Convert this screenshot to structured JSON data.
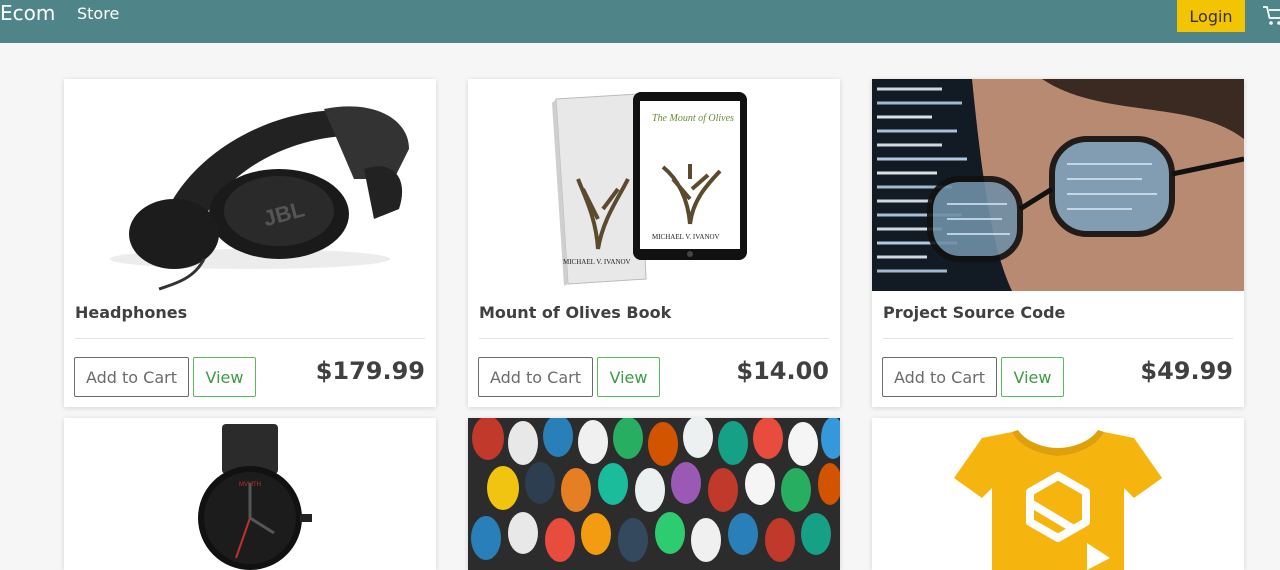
{
  "navbar": {
    "brand": "Ecom",
    "links": [
      "Store"
    ],
    "login_label": "Login"
  },
  "products": [
    {
      "title": "Headphones",
      "price": "$179.99",
      "add_label": "Add to Cart",
      "view_label": "View"
    },
    {
      "title": "Mount of Olives Book",
      "price": "$14.00",
      "add_label": "Add to Cart",
      "view_label": "View",
      "book_cover_title": "The Mount of Olives",
      "book_author": "MICHAEL V. IVANOV"
    },
    {
      "title": "Project Source Code",
      "price": "$49.99",
      "add_label": "Add to Cart",
      "view_label": "View"
    },
    {
      "brand_text": "MVMTH"
    },
    {},
    {}
  ],
  "colors": {
    "navbar": "#4f8588",
    "login_button": "#f3c402",
    "view_border": "#5cb85c",
    "page_background": "#f6f6f6"
  },
  "icons": {
    "cart": "shopping-cart-icon"
  }
}
